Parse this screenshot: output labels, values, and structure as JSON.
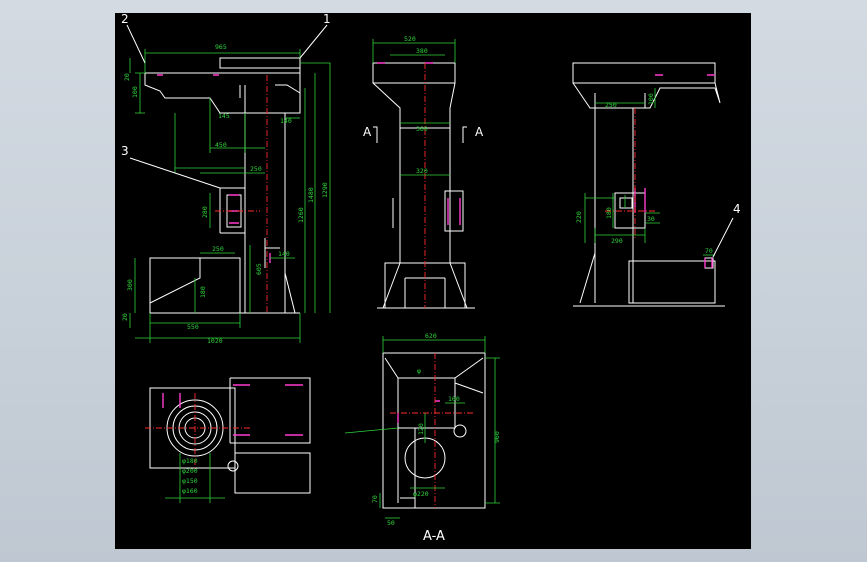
{
  "callouts": [
    "1",
    "2",
    "3",
    "4"
  ],
  "section_marker": "A",
  "section_title": "A-A",
  "front": {
    "dims": [
      "965",
      "20",
      "100",
      "145",
      "450",
      "250",
      "140",
      "1260",
      "1480",
      "1290",
      "280",
      "250",
      "605",
      "140",
      "300",
      "180",
      "20",
      "550",
      "1020"
    ]
  },
  "side": {
    "dims": [
      "520",
      "380",
      "360",
      "320"
    ]
  },
  "back": {
    "dims": [
      "250",
      "100",
      "180",
      "30",
      "220",
      "290",
      "70"
    ]
  },
  "plan_left": {
    "dims": [
      "φ180",
      "φ200",
      "φ150",
      "φ160"
    ]
  },
  "plan_section": {
    "dims": [
      "620",
      "φ",
      "100",
      "120",
      "960",
      "φ220",
      "70",
      "50"
    ]
  },
  "colors": {
    "background": "#000000",
    "outline": "#ffffff",
    "dimension": "#2fd43a",
    "highlight": "#ff3bd0",
    "centerline": "#ff2a2a",
    "frame": "#c9d1da"
  }
}
